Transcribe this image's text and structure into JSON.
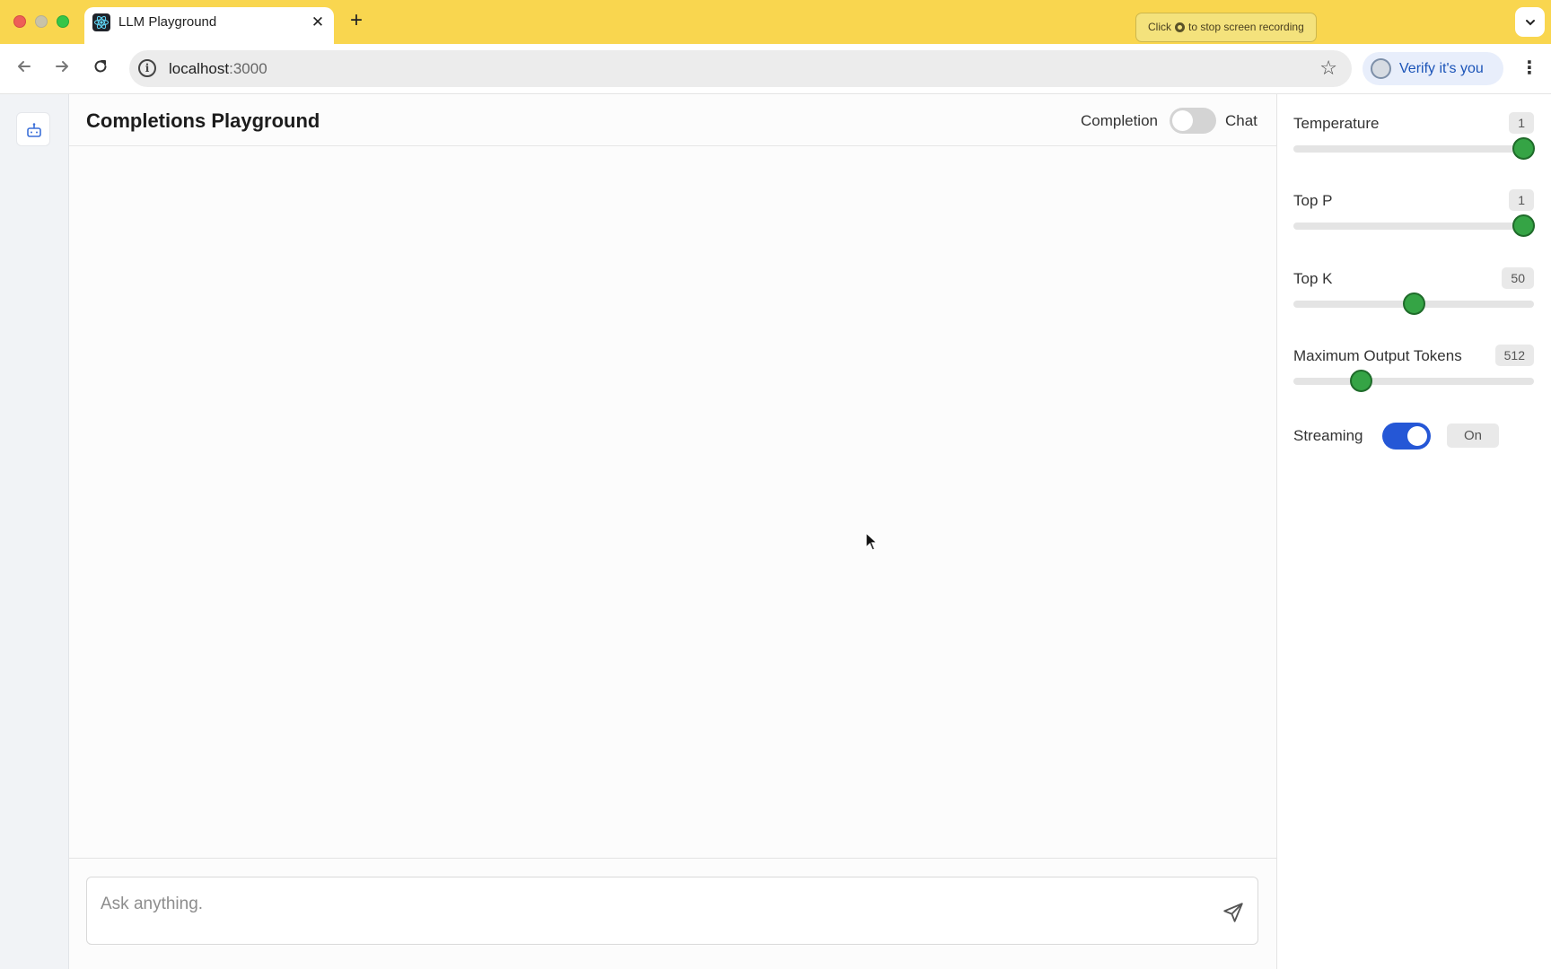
{
  "browser": {
    "tab_title": "LLM Playground",
    "recording_notice": {
      "prefix": "Click",
      "suffix": "to stop screen recording"
    },
    "url_host": "localhost",
    "url_port": ":3000",
    "verify_label": "Verify it's you"
  },
  "app": {
    "title": "Completions Playground",
    "mode": {
      "left_label": "Completion",
      "right_label": "Chat",
      "selected": "Completion"
    },
    "composer": {
      "placeholder": "Ask anything."
    }
  },
  "parameters": [
    {
      "label": "Temperature",
      "value": "1",
      "fraction": 1.0
    },
    {
      "label": "Top P",
      "value": "1",
      "fraction": 1.0
    },
    {
      "label": "Top K",
      "value": "50",
      "fraction": 0.5
    },
    {
      "label": "Maximum Output Tokens",
      "value": "512",
      "fraction": 0.26
    }
  ],
  "streaming": {
    "label": "Streaming",
    "enabled": true,
    "state_label": "On"
  },
  "colors": {
    "tabbar_bg": "#f9d64f",
    "accent_blue": "#2557d6",
    "slider_thumb": "#35a445"
  }
}
